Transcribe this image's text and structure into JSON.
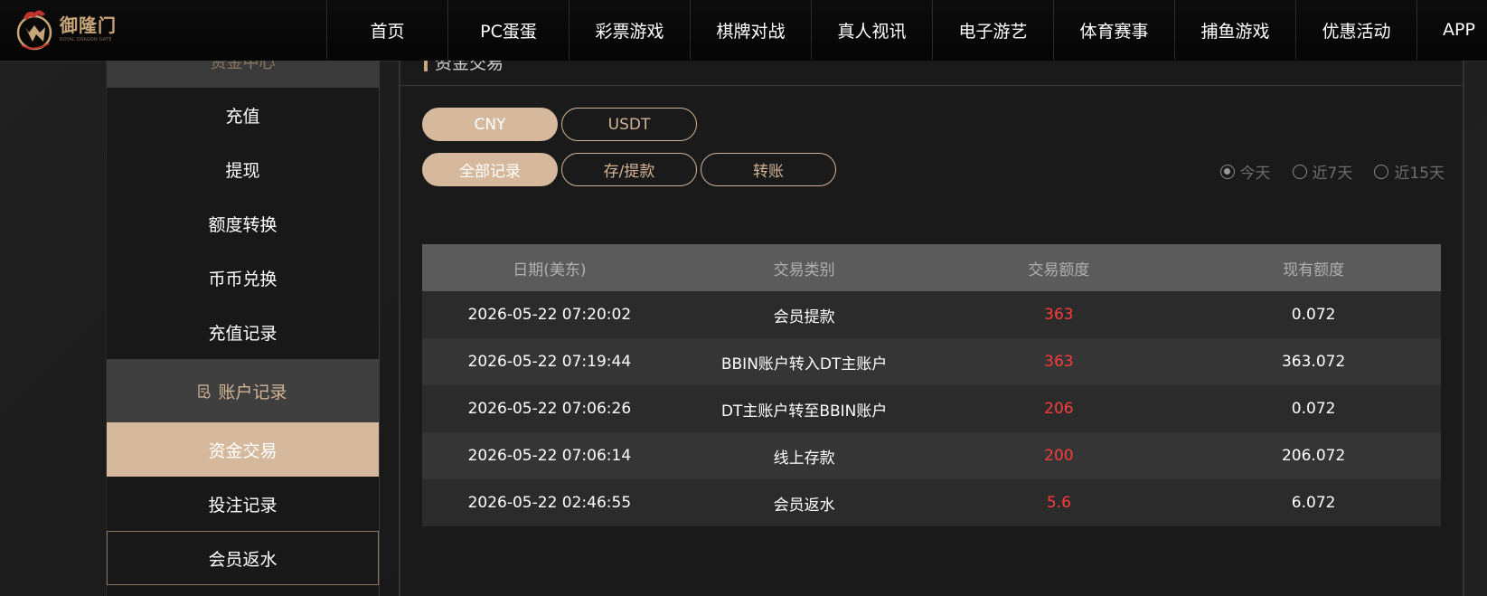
{
  "header": {
    "logo_name": "御隆门",
    "logo_sub": "ROYAL DRAGON GATE",
    "nav": [
      "首页",
      "PC蛋蛋",
      "彩票游戏",
      "棋牌对战",
      "真人视讯",
      "电子游艺",
      "体育赛事",
      "捕鱼游戏",
      "优惠活动",
      "APP"
    ]
  },
  "sidebar": {
    "top_label": "资金中心",
    "items_a": [
      "充值",
      "提现",
      "额度转换",
      "币币兑换",
      "充值记录"
    ],
    "section_label": "账户记录",
    "items_b": [
      "资金交易",
      "投注记录",
      "会员返水"
    ]
  },
  "main": {
    "title": "资金交易",
    "currency_buttons": [
      "CNY",
      "USDT"
    ],
    "filter_buttons": [
      "全部记录",
      "存/提款",
      "转账"
    ],
    "radios": [
      "今天",
      "近7天",
      "近15天"
    ]
  },
  "table": {
    "headers": [
      "日期(美东)",
      "交易类别",
      "交易额度",
      "现有额度"
    ],
    "rows": [
      [
        "2026-05-22 07:20:02",
        "会员提款",
        "363",
        "0.072"
      ],
      [
        "2026-05-22 07:19:44",
        "BBIN账户转入DT主账户",
        "363",
        "363.072"
      ],
      [
        "2026-05-22 07:06:26",
        "DT主账户转至BBIN账户",
        "206",
        "0.072"
      ],
      [
        "2026-05-22 07:06:14",
        "线上存款",
        "200",
        "206.072"
      ],
      [
        "2026-05-22 02:46:55",
        "会员返水",
        "5.6",
        "6.072"
      ]
    ]
  },
  "colors": {
    "accent": "#d6b99c",
    "amount_red": "#ff3b3b",
    "header_bg": "#0a0a0a"
  }
}
